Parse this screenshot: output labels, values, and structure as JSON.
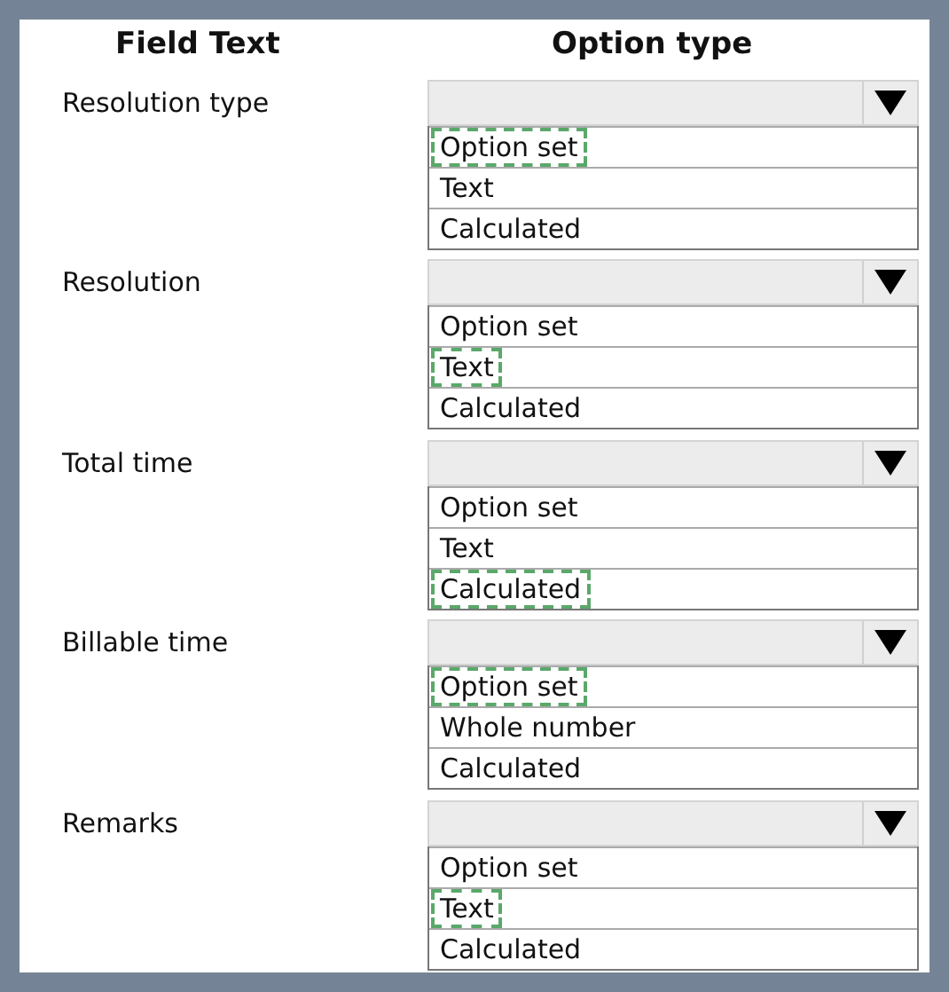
{
  "headers": {
    "field": "Field Text",
    "option": "Option type"
  },
  "rows": [
    {
      "label": "Resolution type",
      "options": [
        {
          "label": "Option set",
          "selected": true
        },
        {
          "label": "Text",
          "selected": false
        },
        {
          "label": "Calculated",
          "selected": false
        }
      ]
    },
    {
      "label": "Resolution",
      "options": [
        {
          "label": "Option set",
          "selected": false
        },
        {
          "label": "Text",
          "selected": true
        },
        {
          "label": "Calculated",
          "selected": false
        }
      ]
    },
    {
      "label": "Total time",
      "options": [
        {
          "label": "Option set",
          "selected": false
        },
        {
          "label": "Text",
          "selected": false
        },
        {
          "label": "Calculated",
          "selected": true
        }
      ]
    },
    {
      "label": "Billable time",
      "options": [
        {
          "label": "Option set",
          "selected": true
        },
        {
          "label": "Whole number",
          "selected": false
        },
        {
          "label": "Calculated",
          "selected": false
        }
      ]
    },
    {
      "label": "Remarks",
      "options": [
        {
          "label": "Option set",
          "selected": false
        },
        {
          "label": "Text",
          "selected": true
        },
        {
          "label": "Calculated",
          "selected": false
        }
      ]
    }
  ]
}
